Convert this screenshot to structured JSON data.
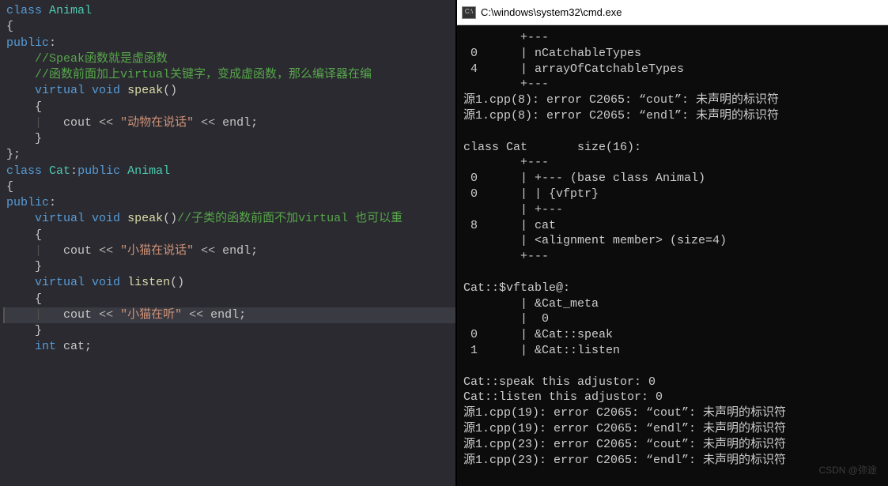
{
  "editor": {
    "lines": [
      {
        "tokens": [
          {
            "c": "kw",
            "t": "class"
          },
          {
            "c": "plain",
            "t": " "
          },
          {
            "c": "type",
            "t": "Animal"
          }
        ]
      },
      {
        "tokens": [
          {
            "c": "brace",
            "t": "{"
          }
        ]
      },
      {
        "tokens": [
          {
            "c": "pub",
            "t": "public"
          },
          {
            "c": "plain",
            "t": ":"
          }
        ]
      },
      {
        "tokens": [
          {
            "c": "plain",
            "t": "    "
          },
          {
            "c": "cmt",
            "t": "//Speak函数就是虚函数"
          }
        ]
      },
      {
        "tokens": [
          {
            "c": "plain",
            "t": "    "
          },
          {
            "c": "cmt",
            "t": "//函数前面加上virtual关键字，变成虚函数，那么编译器在编"
          }
        ]
      },
      {
        "tokens": [
          {
            "c": "plain",
            "t": "    "
          },
          {
            "c": "kw",
            "t": "virtual"
          },
          {
            "c": "plain",
            "t": " "
          },
          {
            "c": "kw",
            "t": "void"
          },
          {
            "c": "plain",
            "t": " "
          },
          {
            "c": "fn",
            "t": "speak"
          },
          {
            "c": "plain",
            "t": "()"
          }
        ]
      },
      {
        "tokens": [
          {
            "c": "plain",
            "t": "    "
          },
          {
            "c": "brace",
            "t": "{"
          }
        ]
      },
      {
        "tokens": [
          {
            "c": "plain",
            "t": "    "
          },
          {
            "c": "guide",
            "t": "|"
          },
          {
            "c": "plain",
            "t": "   "
          },
          {
            "c": "plain",
            "t": "cout "
          },
          {
            "c": "op",
            "t": "<<"
          },
          {
            "c": "plain",
            "t": " "
          },
          {
            "c": "str",
            "t": "\"动物在说话\""
          },
          {
            "c": "plain",
            "t": " "
          },
          {
            "c": "op",
            "t": "<<"
          },
          {
            "c": "plain",
            "t": " endl;"
          }
        ]
      },
      {
        "tokens": [
          {
            "c": "plain",
            "t": "    "
          },
          {
            "c": "brace",
            "t": "}"
          }
        ]
      },
      {
        "tokens": [
          {
            "c": "plain",
            "t": ""
          }
        ]
      },
      {
        "tokens": [
          {
            "c": "plain",
            "t": ""
          }
        ]
      },
      {
        "tokens": [
          {
            "c": "brace",
            "t": "};"
          }
        ]
      },
      {
        "tokens": [
          {
            "c": "plain",
            "t": ""
          }
        ]
      },
      {
        "tokens": [
          {
            "c": "kw",
            "t": "class"
          },
          {
            "c": "plain",
            "t": " "
          },
          {
            "c": "type",
            "t": "Cat"
          },
          {
            "c": "plain",
            "t": ":"
          },
          {
            "c": "kw",
            "t": "public"
          },
          {
            "c": "plain",
            "t": " "
          },
          {
            "c": "type",
            "t": "Animal"
          }
        ]
      },
      {
        "tokens": [
          {
            "c": "brace",
            "t": "{"
          }
        ]
      },
      {
        "tokens": [
          {
            "c": "pub",
            "t": "public"
          },
          {
            "c": "plain",
            "t": ":"
          }
        ]
      },
      {
        "tokens": [
          {
            "c": "plain",
            "t": "    "
          },
          {
            "c": "kw",
            "t": "virtual"
          },
          {
            "c": "plain",
            "t": " "
          },
          {
            "c": "kw",
            "t": "void"
          },
          {
            "c": "plain",
            "t": " "
          },
          {
            "c": "fn",
            "t": "speak"
          },
          {
            "c": "plain",
            "t": "()"
          },
          {
            "c": "cmt",
            "t": "//子类的函数前面不加virtual 也可以重"
          }
        ]
      },
      {
        "tokens": [
          {
            "c": "plain",
            "t": "    "
          },
          {
            "c": "brace",
            "t": "{"
          }
        ]
      },
      {
        "tokens": [
          {
            "c": "plain",
            "t": "    "
          },
          {
            "c": "guide",
            "t": "|"
          },
          {
            "c": "plain",
            "t": "   "
          },
          {
            "c": "plain",
            "t": "cout "
          },
          {
            "c": "op",
            "t": "<<"
          },
          {
            "c": "plain",
            "t": " "
          },
          {
            "c": "str",
            "t": "\"小猫在说话\""
          },
          {
            "c": "plain",
            "t": " "
          },
          {
            "c": "op",
            "t": "<<"
          },
          {
            "c": "plain",
            "t": " endl;"
          }
        ]
      },
      {
        "tokens": [
          {
            "c": "plain",
            "t": "    "
          },
          {
            "c": "brace",
            "t": "}"
          }
        ]
      },
      {
        "tokens": [
          {
            "c": "plain",
            "t": "    "
          },
          {
            "c": "kw",
            "t": "virtual"
          },
          {
            "c": "plain",
            "t": " "
          },
          {
            "c": "kw",
            "t": "void"
          },
          {
            "c": "plain",
            "t": " "
          },
          {
            "c": "fn",
            "t": "listen"
          },
          {
            "c": "plain",
            "t": "()"
          }
        ]
      },
      {
        "tokens": [
          {
            "c": "plain",
            "t": "    "
          },
          {
            "c": "brace",
            "t": "{"
          }
        ]
      },
      {
        "hl": true,
        "tokens": [
          {
            "c": "plain",
            "t": "    "
          },
          {
            "c": "guide",
            "t": "|"
          },
          {
            "c": "plain",
            "t": "   "
          },
          {
            "c": "plain",
            "t": "cout "
          },
          {
            "c": "op",
            "t": "<<"
          },
          {
            "c": "plain",
            "t": " "
          },
          {
            "c": "str",
            "t": "\"小猫在听\""
          },
          {
            "c": "plain",
            "t": " "
          },
          {
            "c": "op",
            "t": "<<"
          },
          {
            "c": "plain",
            "t": " endl;"
          }
        ]
      },
      {
        "tokens": [
          {
            "c": "plain",
            "t": "    "
          },
          {
            "c": "brace",
            "t": "}"
          }
        ]
      },
      {
        "tokens": [
          {
            "c": "plain",
            "t": "    "
          },
          {
            "c": "kw",
            "t": "int"
          },
          {
            "c": "plain",
            "t": " cat;"
          }
        ]
      }
    ]
  },
  "console": {
    "title": "C:\\windows\\system32\\cmd.exe",
    "icon_label": "C:\\",
    "lines": [
      "        +---",
      " 0      | nCatchableTypes",
      " 4      | arrayOfCatchableTypes",
      "        +---",
      "源1.cpp(8): error C2065: “cout”: 未声明的标识符",
      "源1.cpp(8): error C2065: “endl”: 未声明的标识符",
      "",
      "class Cat       size(16):",
      "        +---",
      " 0      | +--- (base class Animal)",
      " 0      | | {vfptr}",
      "        | +---",
      " 8      | cat",
      "        | <alignment member> (size=4)",
      "        +---",
      "",
      "Cat::$vftable@:",
      "        | &Cat_meta",
      "        |  0",
      " 0      | &Cat::speak",
      " 1      | &Cat::listen",
      "",
      "Cat::speak this adjustor: 0",
      "Cat::listen this adjustor: 0",
      "源1.cpp(19): error C2065: “cout”: 未声明的标识符",
      "源1.cpp(19): error C2065: “endl”: 未声明的标识符",
      "源1.cpp(23): error C2065: “cout”: 未声明的标识符",
      "源1.cpp(23): error C2065: “endl”: 未声明的标识符"
    ]
  },
  "watermark": "CSDN @弥途"
}
